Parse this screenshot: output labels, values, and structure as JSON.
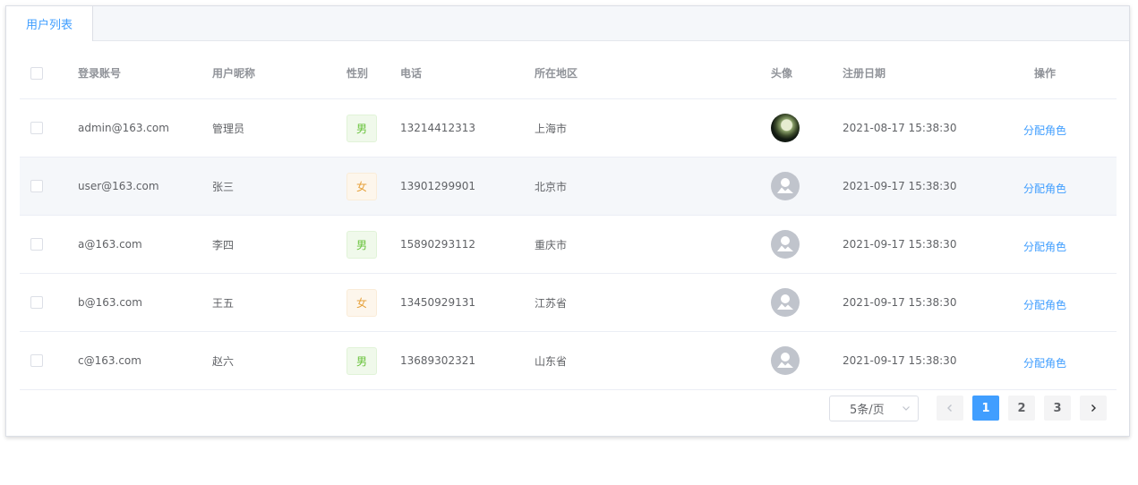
{
  "tabs": [
    {
      "label": "用户列表",
      "active": true
    }
  ],
  "columns": {
    "account": "登录账号",
    "nickname": "用户昵称",
    "gender": "性别",
    "phone": "电话",
    "region": "所在地区",
    "avatar": "头像",
    "reg_date": "注册日期",
    "ops": "操作"
  },
  "rows": [
    {
      "account": "admin@163.com",
      "nickname": "管理员",
      "gender": "男",
      "phone": "13214412313",
      "region": "上海市",
      "avatar": "photo-avatar",
      "reg_date": "2021-08-17 15:38:30",
      "action": "分配角色"
    },
    {
      "account": "user@163.com",
      "nickname": "张三",
      "gender": "女",
      "phone": "13901299901",
      "region": "北京市",
      "avatar": "user-placeholder-icon",
      "reg_date": "2021-09-17 15:38:30",
      "action": "分配角色"
    },
    {
      "account": "a@163.com",
      "nickname": "李四",
      "gender": "男",
      "phone": "15890293112",
      "region": "重庆市",
      "avatar": "user-placeholder-icon",
      "reg_date": "2021-09-17 15:38:30",
      "action": "分配角色"
    },
    {
      "account": "b@163.com",
      "nickname": "王五",
      "gender": "女",
      "phone": "13450929131",
      "region": "江苏省",
      "avatar": "user-placeholder-icon",
      "reg_date": "2021-09-17 15:38:30",
      "action": "分配角色"
    },
    {
      "account": "c@163.com",
      "nickname": "赵六",
      "gender": "男",
      "phone": "13689302321",
      "region": "山东省",
      "avatar": "user-placeholder-icon",
      "reg_date": "2021-09-17 15:38:30",
      "action": "分配角色"
    }
  ],
  "pagination": {
    "page_size": "5条/页",
    "pages": [
      "1",
      "2",
      "3"
    ],
    "current": "1"
  },
  "colors": {
    "primary": "#409eff",
    "male_tag": "#67c23a",
    "female_tag": "#e6a23c",
    "row_highlight": "#f5f7fa"
  }
}
